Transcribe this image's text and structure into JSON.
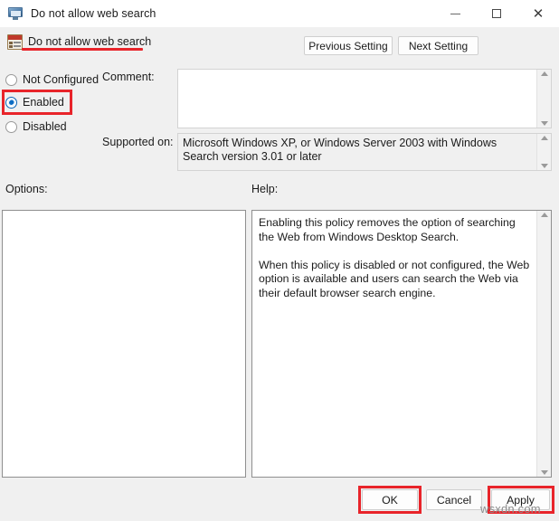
{
  "window": {
    "title": "Do not allow web search",
    "icon": "computer-monitor-icon",
    "controls": {
      "minimize": "minimize-icon",
      "maximize": "maximize-icon",
      "close": "close-icon"
    }
  },
  "header": {
    "policy_title": "Do not allow web search",
    "policy_icon": "group-policy-setting-icon",
    "previous_setting_label": "Previous Setting",
    "next_setting_label": "Next Setting"
  },
  "state_options": {
    "items": [
      {
        "label": "Not Configured",
        "selected": false
      },
      {
        "label": "Enabled",
        "selected": true
      },
      {
        "label": "Disabled",
        "selected": false
      }
    ]
  },
  "comment": {
    "label": "Comment:",
    "value": "",
    "placeholder": ""
  },
  "supported_on": {
    "label": "Supported on:",
    "value": "Microsoft Windows XP, or Windows Server 2003 with Windows Search version 3.01 or later"
  },
  "options": {
    "label": "Options:",
    "value": ""
  },
  "help": {
    "label": "Help:",
    "text": "Enabling this policy removes the option of searching the Web from Windows Desktop Search.\n\nWhen this policy is disabled or not configured, the Web option is available and users can search the Web via their default browser search engine."
  },
  "footer": {
    "ok_label": "OK",
    "cancel_label": "Cancel",
    "apply_label": "Apply"
  },
  "watermark": {
    "text": "wsxdn.com"
  },
  "annotations": {
    "color": "#e8242a",
    "targets": [
      "enabled-radio",
      "policy-title-underline",
      "ok-button",
      "apply-button"
    ]
  }
}
